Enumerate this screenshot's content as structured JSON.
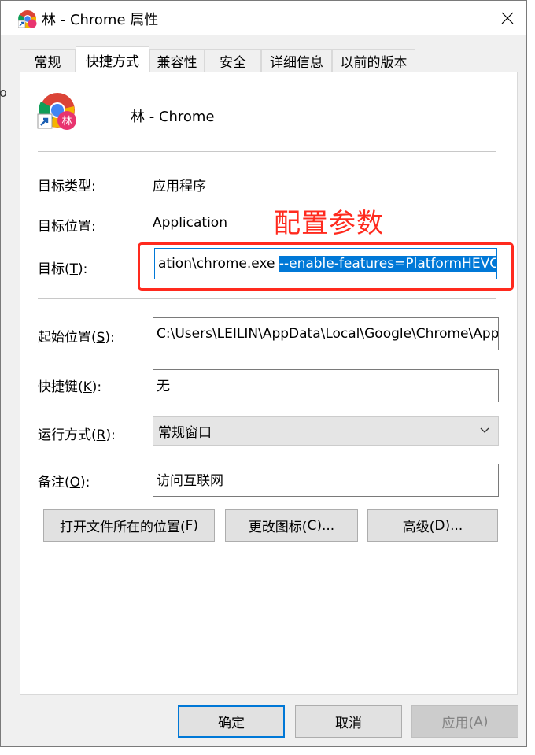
{
  "window": {
    "title": "林 - Chrome 属性",
    "left_sliver": "or"
  },
  "tabs": [
    {
      "label": "常规"
    },
    {
      "label": "快捷方式",
      "active": true
    },
    {
      "label": "兼容性"
    },
    {
      "label": "安全"
    },
    {
      "label": "详细信息"
    },
    {
      "label": "以前的版本"
    }
  ],
  "header": {
    "app_name": "林 - Chrome",
    "icon": "chrome-shortcut-icon",
    "badge_text": "林"
  },
  "fields": {
    "target_type_label": "目标类型:",
    "target_type_value": "应用程序",
    "target_location_label": "目标位置:",
    "target_location_value": "Application",
    "target_label_pre": "目标(",
    "target_label_key": "T",
    "target_label_post": "):",
    "target_value_plain": "ation\\chrome.exe ",
    "target_value_selected": "--enable-features=PlatformHEVC",
    "start_in_label_pre": "起始位置(",
    "start_in_label_key": "S",
    "start_in_label_post": "):",
    "start_in_value": "C:\\Users\\LEILIN\\AppData\\Local\\Google\\Chrome\\Application",
    "hotkey_label_pre": "快捷键(",
    "hotkey_label_key": "K",
    "hotkey_label_post": "):",
    "hotkey_value": "无",
    "run_label_pre": "运行方式(",
    "run_label_key": "R",
    "run_label_post": "):",
    "run_value": "常规窗口",
    "comment_label_pre": "备注(",
    "comment_label_key": "O",
    "comment_label_post": "):",
    "comment_value": "访问互联网"
  },
  "annotation": {
    "text": "配置参数",
    "color": "#ff2a1e"
  },
  "action_buttons": {
    "open_location_pre": "打开文件所在的位置(",
    "open_location_key": "F",
    "open_location_post": ")",
    "change_icon_pre": "更改图标(",
    "change_icon_key": "C",
    "change_icon_post": ")...",
    "advanced_pre": "高级(",
    "advanced_key": "D",
    "advanced_post": ")..."
  },
  "footer": {
    "ok_label": "确定",
    "cancel_label": "取消",
    "apply_pre": "应用(",
    "apply_key": "A",
    "apply_post": ")"
  },
  "colors": {
    "selection": "#0078d7",
    "annotation_red": "#ff2a1e",
    "dialog_bg": "#f0f0f0"
  }
}
